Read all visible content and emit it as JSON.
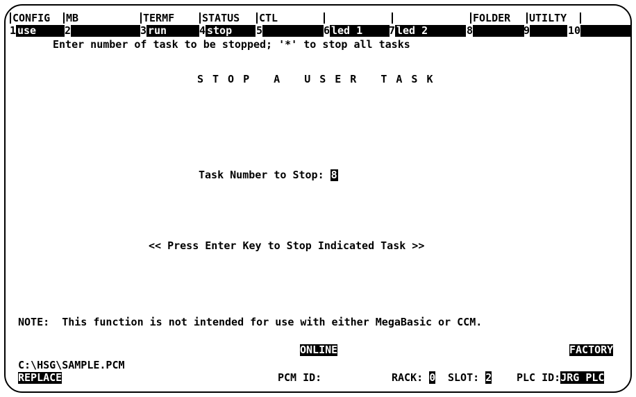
{
  "menu": {
    "headers": [
      "CONFIG",
      "MB",
      "TERMF",
      "STATUS",
      "CTL",
      "",
      "",
      "FOLDER",
      "UTILTY",
      ""
    ],
    "keys": [
      {
        "num": "1",
        "label": "use"
      },
      {
        "num": "2",
        "label": ""
      },
      {
        "num": "3",
        "label": "run"
      },
      {
        "num": "4",
        "label": "stop"
      },
      {
        "num": "5",
        "label": ""
      },
      {
        "num": "6",
        "label": "led 1"
      },
      {
        "num": "7",
        "label": "led 2"
      },
      {
        "num": "8",
        "label": ""
      },
      {
        "num": "9",
        "label": ""
      },
      {
        "num": "10",
        "label": ""
      }
    ]
  },
  "prompt": "Enter number of task to be stopped; '*' to stop all tasks",
  "screen_title": "STOP A USER TASK",
  "task_field": {
    "label": "Task Number to Stop:",
    "value": "8"
  },
  "instruction": "<< Press Enter Key to Stop Indicated Task >>",
  "note": "NOTE:  This function is not intended for use with either MegaBasic or CCM.",
  "status": {
    "online": "ONLINE",
    "factory": "FACTORY",
    "file_path": "C:\\HSG\\SAMPLE.PCM",
    "mode": "REPLACE",
    "pcm_id_label": "PCM ID:",
    "rack_label": "RACK:",
    "rack_value": "0",
    "slot_label": "SLOT:",
    "slot_value": "2",
    "plc_id_label": "PLC ID:",
    "plc_id_value": "JRG PLC"
  }
}
